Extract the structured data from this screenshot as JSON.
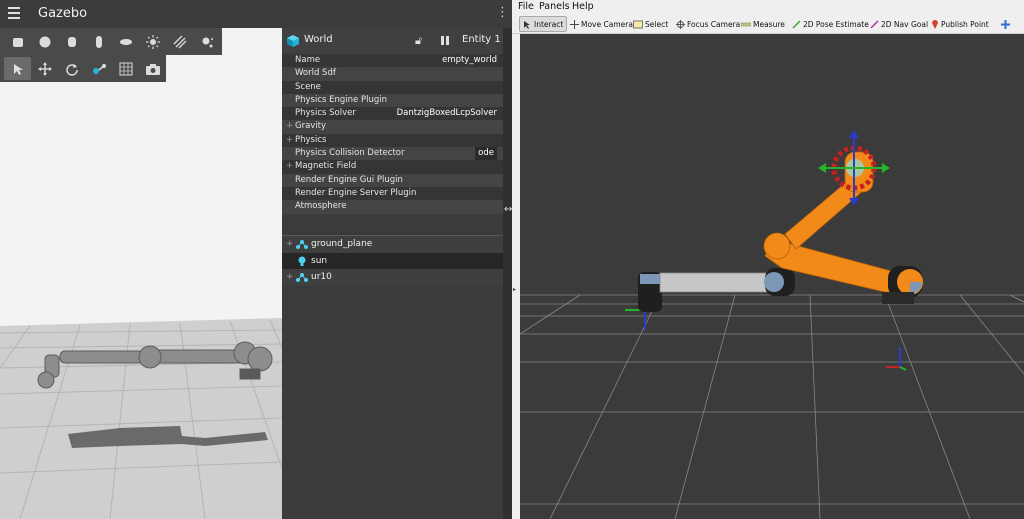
{
  "gazebo": {
    "title": "Gazebo",
    "kebab": "⋮",
    "toolbar_shapes": [
      "box",
      "sphere",
      "cylinder",
      "capsule",
      "ellipsoid",
      "sun",
      "directional-light",
      "point-light"
    ],
    "toolbar_transform": [
      "select",
      "translate",
      "rotate",
      "snap",
      "grid",
      "screenshot"
    ],
    "panel": {
      "title": "World",
      "entity_label": "Entity 1",
      "properties": [
        {
          "name": "Name",
          "value": "empty_world",
          "expandable": false
        },
        {
          "name": "World Sdf",
          "value": "",
          "expandable": false
        },
        {
          "name": "Scene",
          "value": "",
          "expandable": false
        },
        {
          "name": "Physics Engine Plugin",
          "value": "",
          "expandable": false
        },
        {
          "name": "Physics Solver",
          "value": "DantzigBoxedLcpSolver",
          "expandable": false
        },
        {
          "name": "Gravity",
          "value": "",
          "expandable": true
        },
        {
          "name": "Physics",
          "value": "",
          "expandable": true
        },
        {
          "name": "Physics Collision Detector",
          "value": "ode",
          "expandable": false
        },
        {
          "name": "Magnetic Field",
          "value": "",
          "expandable": true
        },
        {
          "name": "Render Engine Gui Plugin",
          "value": "",
          "expandable": false
        },
        {
          "name": "Render Engine Server Plugin",
          "value": "",
          "expandable": false
        },
        {
          "name": "Atmosphere",
          "value": "",
          "expandable": false
        }
      ],
      "entities": [
        {
          "name": "ground_plane",
          "icon": "model-icon",
          "expandable": true,
          "selected": false
        },
        {
          "name": "sun",
          "icon": "light-icon",
          "expandable": false,
          "selected": true
        },
        {
          "name": "ur10",
          "icon": "model-icon",
          "expandable": true,
          "selected": false
        }
      ]
    }
  },
  "rviz": {
    "menu": [
      "File",
      "Panels",
      "Help"
    ],
    "tools": [
      {
        "label": "Interact",
        "icon": "interact-icon",
        "active": true
      },
      {
        "label": "Move Camera",
        "icon": "move-camera-icon",
        "active": false
      },
      {
        "label": "Select",
        "icon": "select-icon",
        "active": false
      },
      {
        "label": "Focus Camera",
        "icon": "focus-camera-icon",
        "active": false
      },
      {
        "label": "Measure",
        "icon": "measure-icon",
        "active": false
      },
      {
        "label": "2D Pose Estimate",
        "icon": "pose-estimate-icon",
        "active": false
      },
      {
        "label": "2D Nav Goal",
        "icon": "nav-goal-icon",
        "active": false
      },
      {
        "label": "Publish Point",
        "icon": "publish-point-icon",
        "active": false
      }
    ],
    "add_tool_icon": "plus-icon"
  },
  "colors": {
    "accent_cyan": "#21b5d9",
    "robot_orange": "#f28a1a",
    "robot_gray": "#bdbdbd",
    "rviz_bg": "#3a3a3a"
  }
}
